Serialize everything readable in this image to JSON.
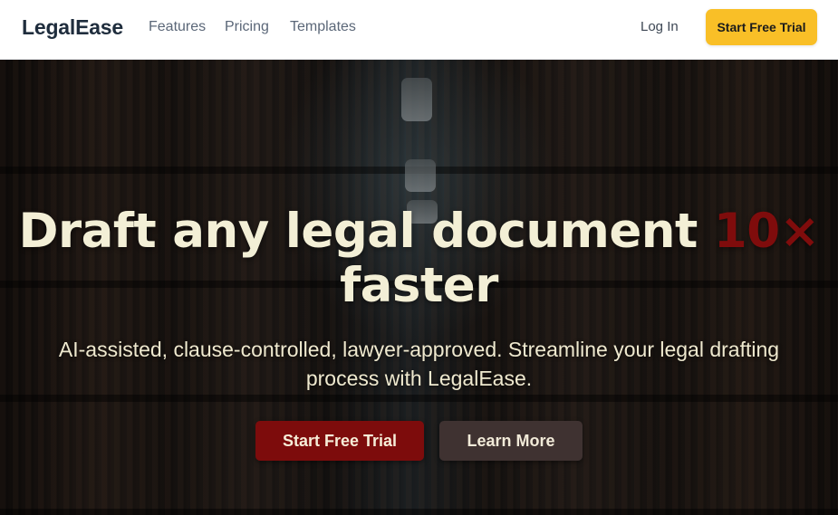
{
  "nav": {
    "brand": "LegalEase",
    "links": [
      "Features",
      "Pricing",
      "Templates"
    ],
    "login_label": "Log In",
    "trial_label": "Start Free Trial"
  },
  "hero": {
    "title_main": "Draft any legal document",
    "title_accent": "10×",
    "title_end": "faster",
    "subtitle": "AI-assisted, clause-controlled, lawyer-approved. Streamline your legal drafting process with LegalEase.",
    "primary_cta": "Start Free Trial",
    "secondary_cta": "Learn More"
  },
  "colors": {
    "accent_red": "#7d0c0c",
    "cta_yellow": "#f9bf27",
    "secondary_button": "#3f3231",
    "hero_text": "#f3efd6",
    "nav_text": "#5b6778"
  }
}
